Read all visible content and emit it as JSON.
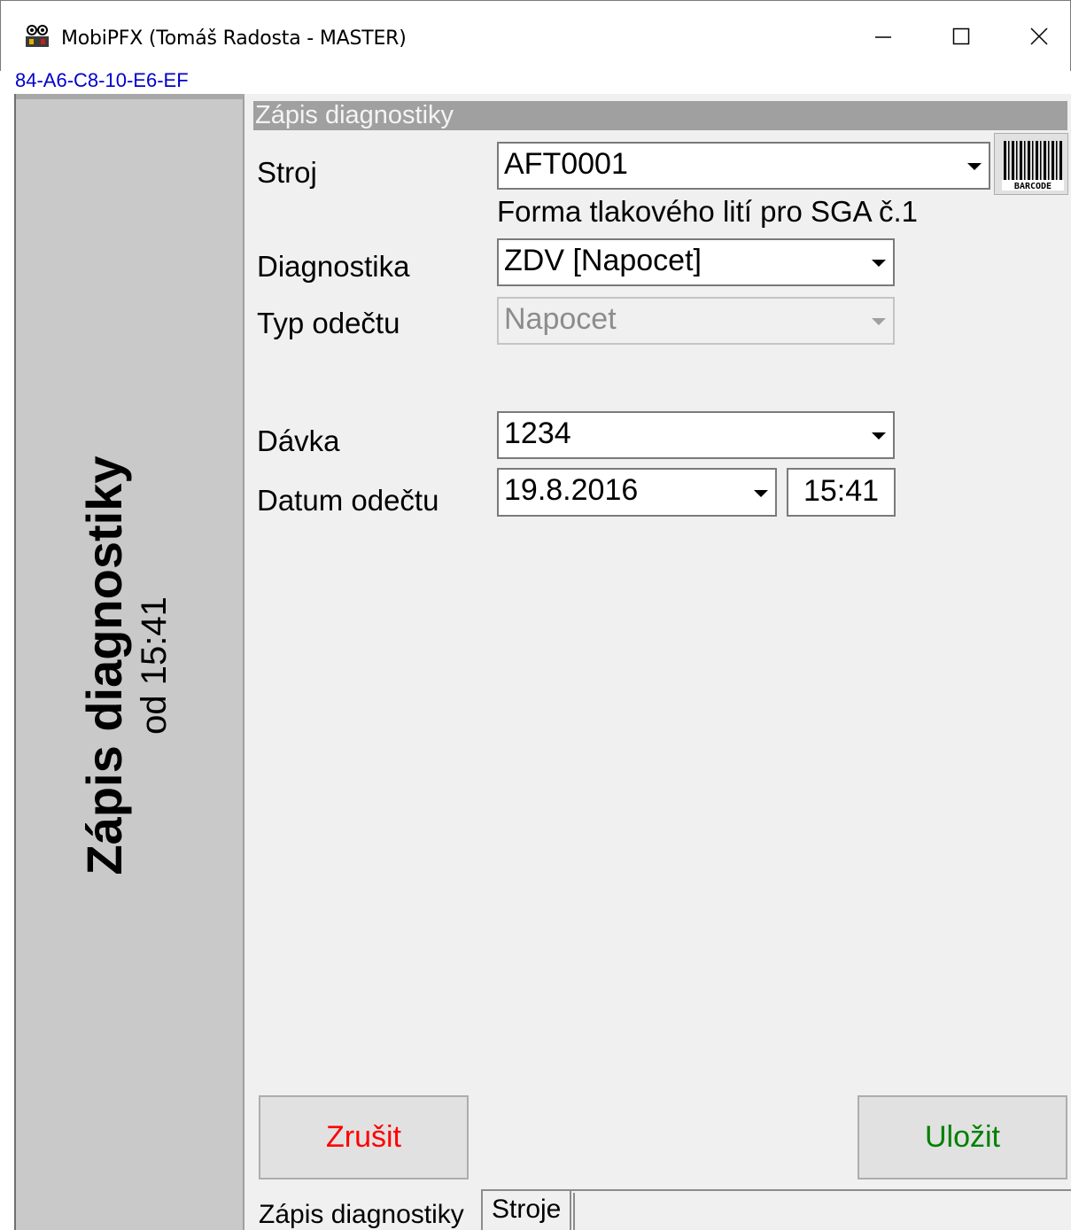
{
  "window": {
    "title": "MobiPFX (Tomáš Radosta - MASTER)",
    "mac_address": "84-A6-C8-10-E6-EF"
  },
  "side_panel": {
    "title": "Zápis diagnostiky",
    "subtitle": "od 15:41"
  },
  "form": {
    "header": "Zápis diagnostiky",
    "stroj": {
      "label": "Stroj",
      "value": "AFT0001",
      "description": "Forma tlakového lití pro SGA č.1"
    },
    "barcode": {
      "icon": "barcode-icon",
      "text": "BARCODE"
    },
    "diagnostika": {
      "label": "Diagnostika",
      "value": "ZDV [Napocet]"
    },
    "typ_odectu": {
      "label": "Typ odečtu",
      "value": "Napocet",
      "disabled": true
    },
    "davka": {
      "label": "Dávka",
      "value": "1234"
    },
    "datum_odectu": {
      "label": "Datum odečtu",
      "date": "19.8.2016",
      "time": "15:41"
    }
  },
  "buttons": {
    "cancel_label": "Zrušit",
    "save_label": "Uložit",
    "cancel_color": "#ff0000",
    "save_color": "#008000"
  },
  "tabs": [
    {
      "label": "Zápis diagnostiky",
      "active": true
    },
    {
      "label": "Stroje",
      "active": false
    }
  ]
}
